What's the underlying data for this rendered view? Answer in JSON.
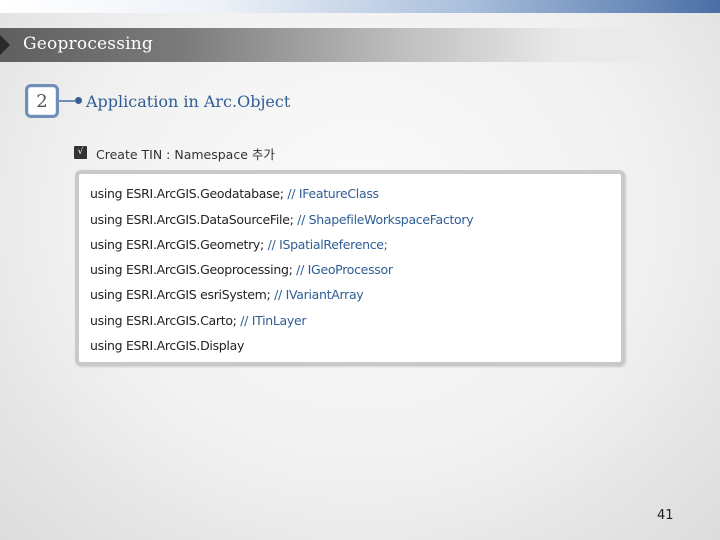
{
  "header": {
    "title": "Geoprocessing"
  },
  "section": {
    "number": "2",
    "title": "Application in Arc.Object"
  },
  "subtitle": "Create TIN : Namespace 추가",
  "code_lines": [
    {
      "code": "using ESRI.ArcGIS.Geodatabase; ",
      "comment": "// IFeatureClass"
    },
    {
      "code": "using ESRI.ArcGIS.DataSourceFile; ",
      "comment": "// ShapefileWorkspaceFactory"
    },
    {
      "code": "using ESRI.ArcGIS.Geometry; ",
      "comment": "// ISpatialReference;"
    },
    {
      "code": "using ESRI.ArcGIS.Geoprocessing; ",
      "comment": "// IGeoProcessor"
    },
    {
      "code": "using ESRI.ArcGIS esriSystem; ",
      "comment": "// IVariantArray"
    },
    {
      "code": "using ESRI.ArcGIS.Carto; ",
      "comment": "// ITinLayer"
    },
    {
      "code": "using ESRI.ArcGIS.Display",
      "comment": ""
    }
  ],
  "page_number": "41"
}
